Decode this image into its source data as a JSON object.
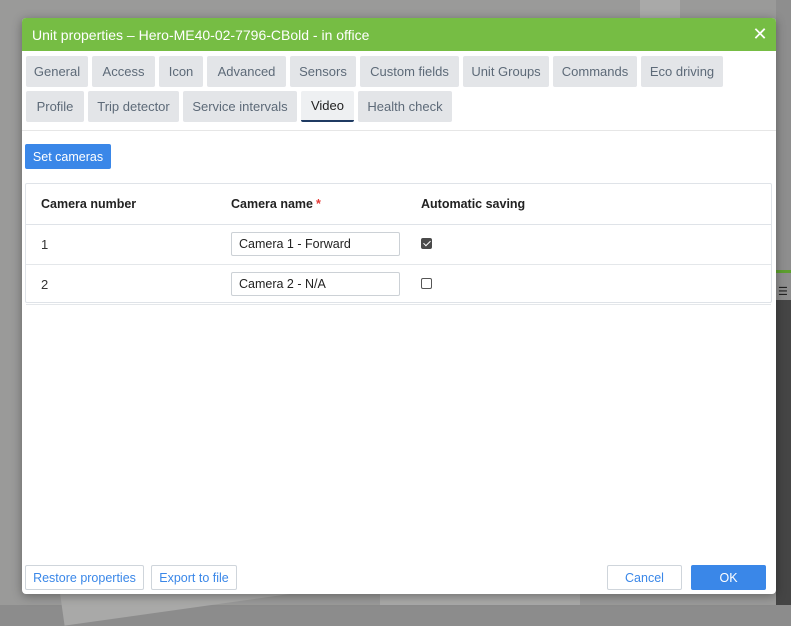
{
  "dialog": {
    "title": "Unit properties – Hero-ME40-02-7796-CBold - in office",
    "close_icon": "close-icon"
  },
  "tabs": [
    {
      "label": "General",
      "active": false
    },
    {
      "label": "Access",
      "active": false
    },
    {
      "label": "Icon",
      "active": false
    },
    {
      "label": "Advanced",
      "active": false
    },
    {
      "label": "Sensors",
      "active": false
    },
    {
      "label": "Custom fields",
      "active": false
    },
    {
      "label": "Unit Groups",
      "active": false
    },
    {
      "label": "Commands",
      "active": false
    },
    {
      "label": "Eco driving",
      "active": false
    },
    {
      "label": "Profile",
      "active": false
    },
    {
      "label": "Trip detector",
      "active": false
    },
    {
      "label": "Service intervals",
      "active": false
    },
    {
      "label": "Video",
      "active": true
    },
    {
      "label": "Health check",
      "active": false
    }
  ],
  "video": {
    "set_cameras_label": "Set cameras",
    "columns": {
      "camera_number": "Camera number",
      "camera_name": "Camera name",
      "required_marker": "*",
      "automatic_saving": "Automatic saving"
    },
    "rows": [
      {
        "number": "1",
        "name": "Camera 1 - Forward",
        "automatic_saving": true
      },
      {
        "number": "2",
        "name": "Camera 2 - N/A",
        "automatic_saving": false
      }
    ]
  },
  "footer": {
    "restore_label": "Restore properties",
    "export_label": "Export to file",
    "cancel_label": "Cancel",
    "ok_label": "OK"
  },
  "colors": {
    "titlebar": "#76bd44",
    "accent": "#3a87e8",
    "required": "#e53935"
  }
}
